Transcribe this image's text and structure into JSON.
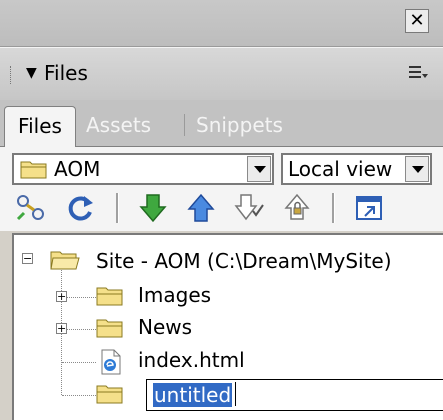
{
  "titlebar": {
    "close_glyph": "✕"
  },
  "panel": {
    "title": "Files"
  },
  "tabs": [
    {
      "label": "Files",
      "active": true
    },
    {
      "label": "Assets",
      "active": false
    },
    {
      "label": "Snippets",
      "active": false
    }
  ],
  "site_select": {
    "value": "AOM"
  },
  "view_select": {
    "value": "Local view"
  },
  "toolbar": {
    "icons": [
      "connect-icon",
      "refresh-icon",
      "get-file-icon",
      "put-file-icon",
      "check-out-icon",
      "check-in-icon",
      "expand-site-icon"
    ]
  },
  "tree": {
    "root": {
      "label": "Site - AOM (C:\\Dream\\MySite)",
      "expander": "−"
    },
    "items": [
      {
        "label": "Images",
        "expander": "+",
        "icon": "folder-icon"
      },
      {
        "label": "News",
        "expander": "+",
        "icon": "folder-icon"
      },
      {
        "label": "index.html",
        "icon": "html-file-icon"
      }
    ],
    "editing": {
      "value": "untitled",
      "icon": "folder-icon"
    }
  },
  "colors": {
    "selection": "#316ac5",
    "panel_bg": "#f4f4f4",
    "folder": "#f5e08a",
    "arrow_green": "#3fa83f",
    "arrow_blue": "#2e74d6"
  }
}
